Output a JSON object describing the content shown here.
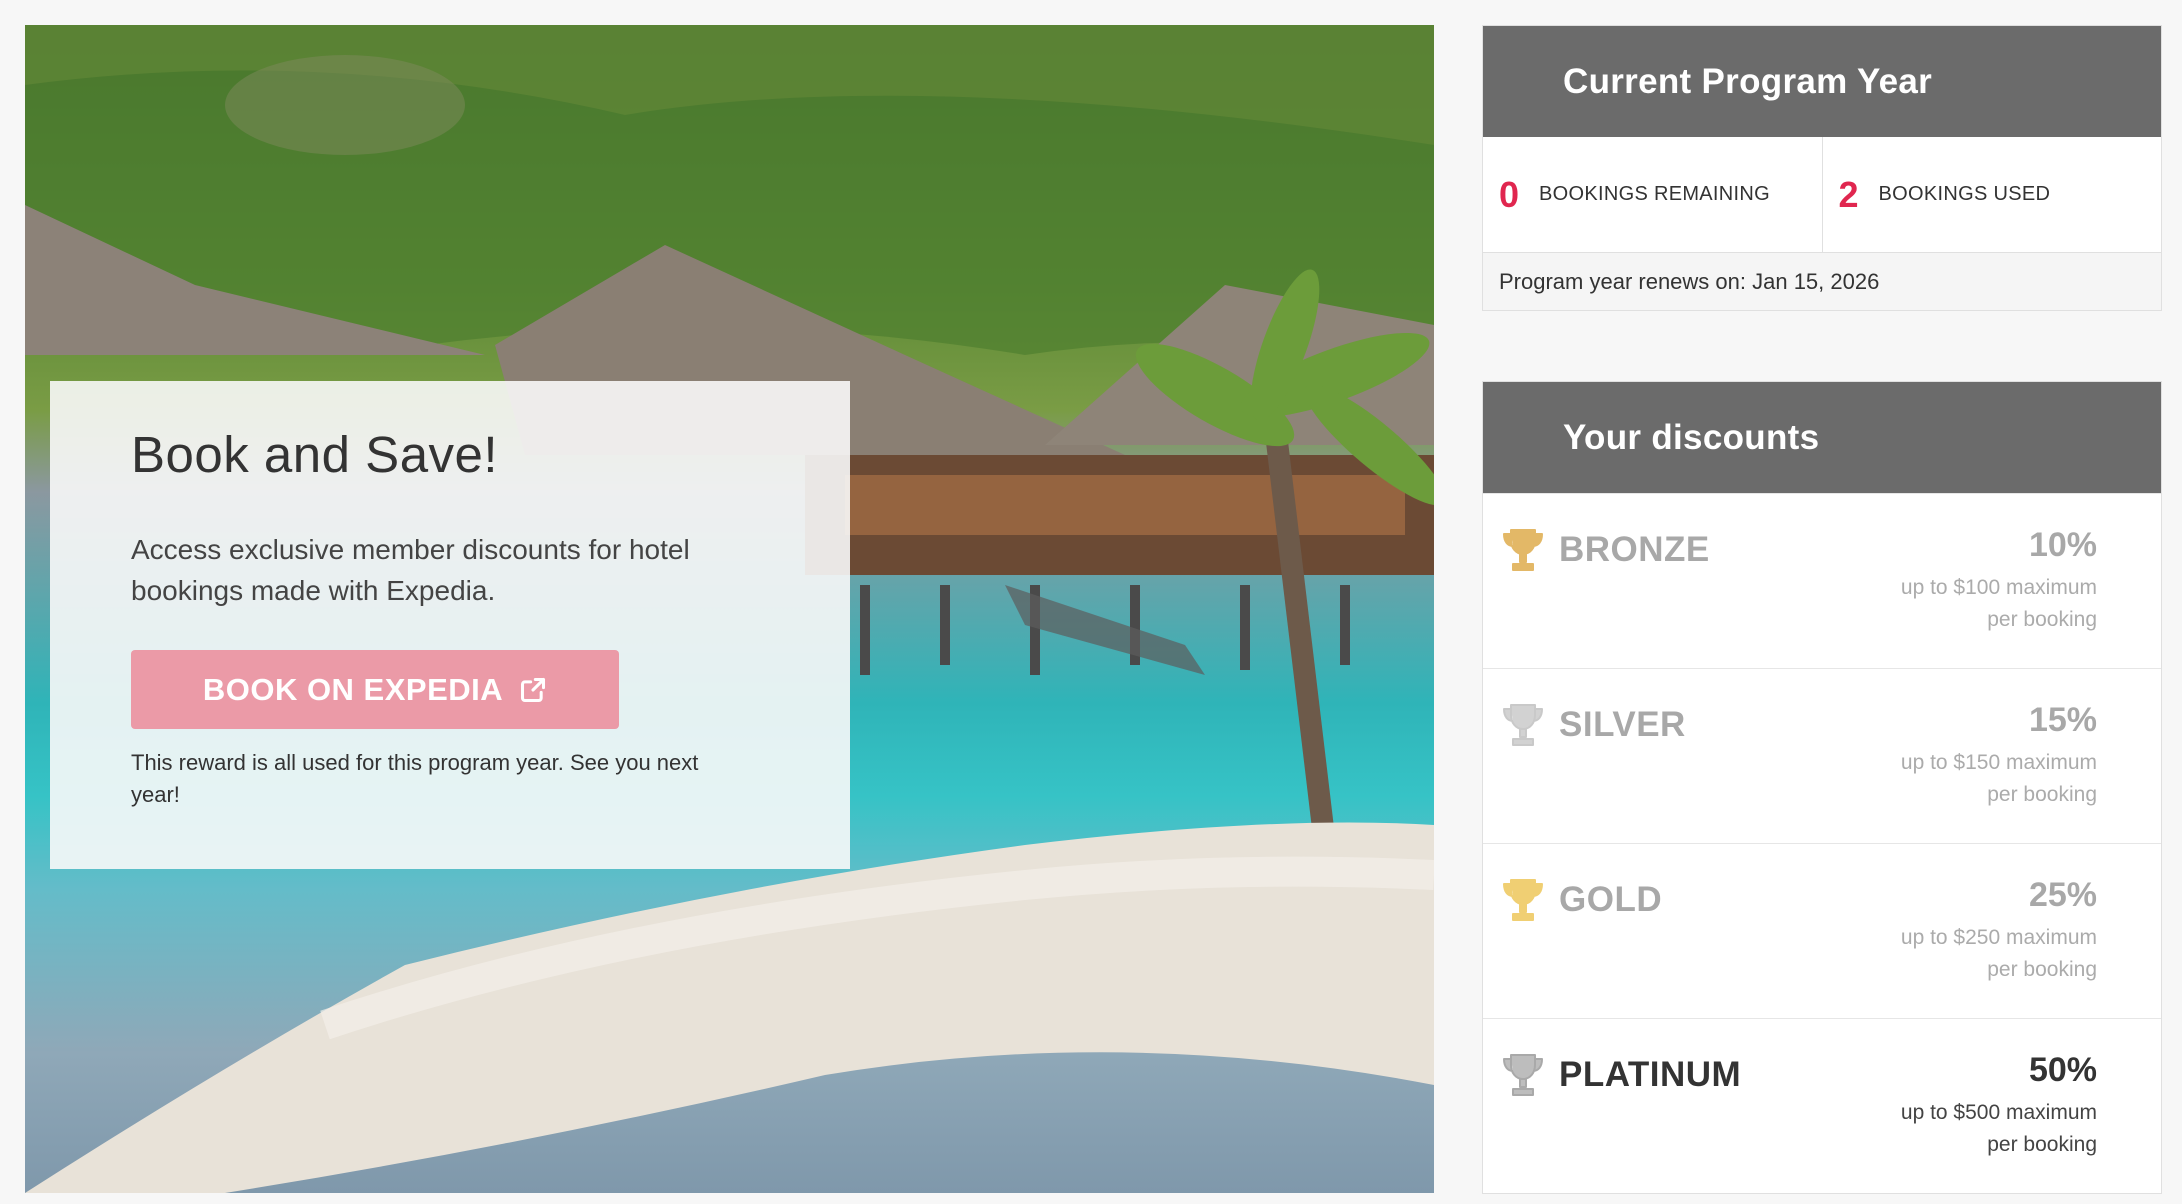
{
  "promo": {
    "title": "Book and Save!",
    "text": "Access exclusive member discounts for hotel bookings made with Expedia.",
    "button_label": "BOOK ON EXPEDIA",
    "note": "This reward is all used for this program year. See you next year!"
  },
  "program": {
    "title": "Current Program Year",
    "remaining_value": "0",
    "remaining_label": "BOOKINGS REMAINING",
    "used_value": "2",
    "used_label": "BOOKINGS USED",
    "renew_text": "Program year renews on: Jan 15, 2026"
  },
  "discounts": {
    "title": "Your discounts",
    "tiers": [
      {
        "name": "BRONZE",
        "percent": "10%",
        "limit": "up to $100 maximum",
        "per": "per booking",
        "icon": "trophy-icon",
        "icon_color": "#e3b867"
      },
      {
        "name": "SILVER",
        "percent": "15%",
        "limit": "up to $150 maximum",
        "per": "per booking",
        "icon": "trophy-icon",
        "icon_color": "#c9c9c9"
      },
      {
        "name": "GOLD",
        "percent": "25%",
        "limit": "up to $250 maximum",
        "per": "per booking",
        "icon": "trophy-icon",
        "icon_color": "#f0cf73"
      },
      {
        "name": "PLATINUM",
        "percent": "50%",
        "limit": "up to $500 maximum",
        "per": "per booking",
        "icon": "trophy-icon",
        "icon_color": "#a9a9a9"
      }
    ]
  },
  "colors": {
    "accent_red": "#e0264f",
    "button_pink": "#eb9aa7",
    "header_gray": "#6b6b6b"
  }
}
